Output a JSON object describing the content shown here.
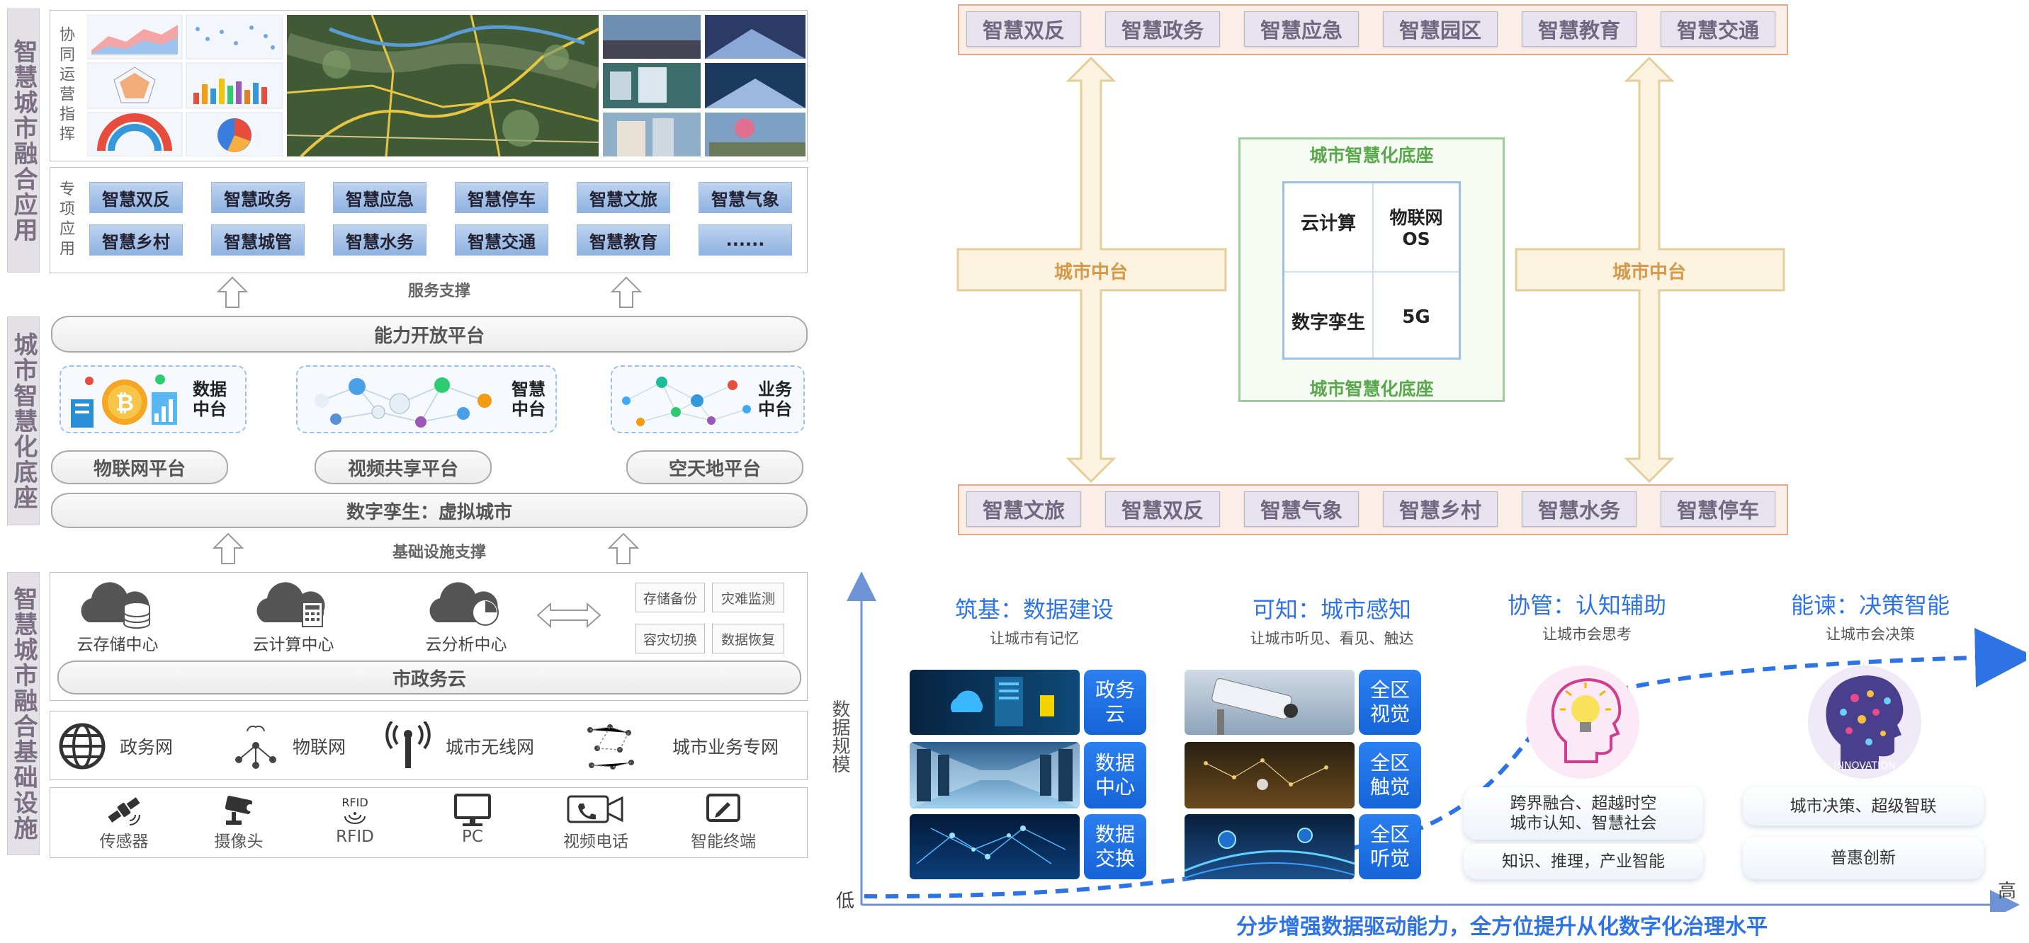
{
  "left": {
    "layer1_label": "智慧城市融合应用",
    "coop_label": "协同运营指挥",
    "special_label": "专项应用",
    "apps_row1": [
      "智慧双反",
      "智慧政务",
      "智慧应急",
      "智慧停车",
      "智慧文旅",
      "智慧气象"
    ],
    "apps_row2": [
      "智慧乡村",
      "智慧城管",
      "智慧水务",
      "智慧交通",
      "智慧教育",
      "......"
    ],
    "service_support": "服务支撑",
    "layer2_label": "城市智慧化底座",
    "capability_platform": "能力开放平台",
    "centers": [
      {
        "name": "数据\n中台"
      },
      {
        "name": "智慧\n中台"
      },
      {
        "name": "业务\n中台"
      }
    ],
    "platforms": [
      "物联网平台",
      "视频共享平台",
      "空天地平台"
    ],
    "digital_twin": "数字孪生：虚拟城市",
    "infra_support": "基础设施支撑",
    "layer3_label": "智慧城市融合基础设施",
    "clouds": [
      "云存储中心",
      "云计算中心",
      "云分析中心"
    ],
    "cloud_services": [
      "存储备份",
      "灾难监测",
      "容灾切换",
      "数据恢复"
    ],
    "gov_cloud": "市政务云",
    "networks": [
      "政务网",
      "物联网",
      "城市无线网",
      "城市业务专网"
    ],
    "devices": [
      "传感器",
      "摄像头",
      "RFID",
      "PC",
      "视频电话",
      "智能终端"
    ],
    "rfid_icon_text": "RFID"
  },
  "top_right": {
    "top_tags": [
      "智慧双反",
      "智慧政务",
      "智慧应急",
      "智慧园区",
      "智慧教育",
      "智慧交通"
    ],
    "bottom_tags": [
      "智慧文旅",
      "智慧双反",
      "智慧气象",
      "智慧乡村",
      "智慧水务",
      "智慧停车"
    ],
    "city_platform_left": "城市中台",
    "city_platform_right": "城市中台",
    "base_title_top": "城市智慧化底座",
    "base_title_bottom": "城市智慧化底座",
    "cells": [
      "云计算",
      "物联网\nOS",
      "数字孪生",
      "5G"
    ]
  },
  "bottom_right": {
    "y_axis_label": "数据规模",
    "low_label": "低",
    "high_label": "高",
    "caption": "分步增强数据驱动能力，全方位提升从化数字化治理水平",
    "stages": [
      {
        "title": "筑基：数据建设",
        "sub": "让城市有记忆"
      },
      {
        "title": "可知：城市感知",
        "sub": "让城市听见、看见、触达"
      },
      {
        "title": "协管：认知辅助",
        "sub": "让城市会思考"
      },
      {
        "title": "能谏：决策智能",
        "sub": "让城市会决策"
      }
    ],
    "stage1_tags": [
      "政务\n云",
      "数据\n中心",
      "数据\n交换"
    ],
    "stage2_tags": [
      "全区\n视觉",
      "全区\n触觉",
      "全区\n听觉"
    ],
    "stage3_pills": [
      "跨界融合、超越时空\n城市认知、智慧社会",
      "知识、推理，产业智能"
    ],
    "stage4_pills": [
      "城市决策、超级智联",
      "普惠创新"
    ],
    "innovation_text": "INNOVATION"
  },
  "colors": {
    "accent_blue": "#2d73e6",
    "orange_border": "#e2a98a",
    "green_border": "#9fcf9a",
    "yellow_arrow": "#e8d7a8"
  }
}
